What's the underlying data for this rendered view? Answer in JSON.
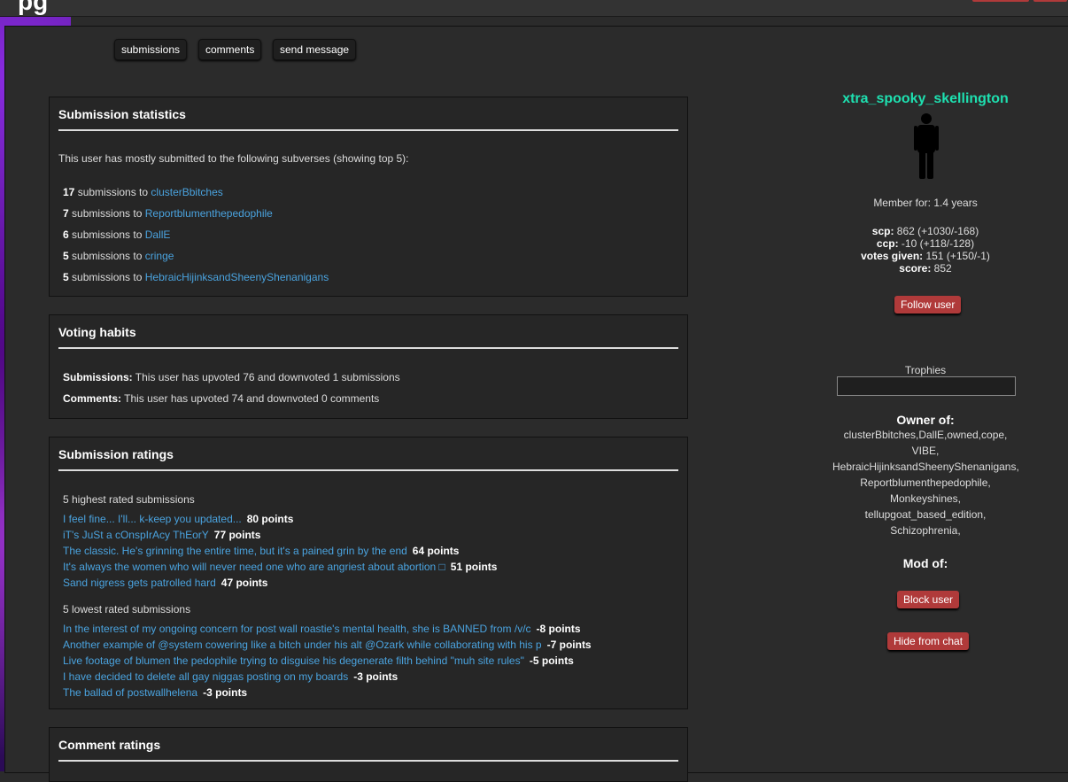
{
  "tabs": [
    "submissions",
    "comments",
    "send message"
  ],
  "stats": {
    "title": "Submission statistics",
    "intro": "This user has mostly submitted to the following subverses (showing top 5):",
    "rows": [
      {
        "count": "17",
        "text": " submissions to ",
        "sub": "clusterBbitches"
      },
      {
        "count": "7",
        "text": " submissions to ",
        "sub": "Reportblumenthepedophile"
      },
      {
        "count": "6",
        "text": " submissions to ",
        "sub": "DallE"
      },
      {
        "count": "5",
        "text": " submissions to ",
        "sub": "cringe"
      },
      {
        "count": "5",
        "text": " submissions to ",
        "sub": "HebraicHijinksandSheenyShenanigans"
      }
    ]
  },
  "voting": {
    "title": "Voting habits",
    "submissions_label": "Submissions:",
    "submissions_text": " This user has upvoted 76 and downvoted 1 submissions",
    "comments_label": "Comments:",
    "comments_text": " This user has upvoted 74 and downvoted 0 comments"
  },
  "ratings": {
    "title": "Submission ratings",
    "highest_label": "5 highest rated submissions",
    "highest": [
      {
        "title": "I feel fine... I'll... k-keep you updated...",
        "points": "80 points"
      },
      {
        "title": "iT's JuSt a cOnspIrAcy ThEorY",
        "points": "77 points"
      },
      {
        "title": "The classic. He's grinning the entire time, but it's a pained grin by the end",
        "points": "64 points"
      },
      {
        "title": "It's always the women who will never need one who are angriest about abortion □",
        "points": "51 points"
      },
      {
        "title": "Sand nigress gets patrolled hard",
        "points": "47 points"
      }
    ],
    "lowest_label": "5 lowest rated submissions",
    "lowest": [
      {
        "title": "In the interest of my ongoing concern for post wall roastie's mental health, she is BANNED from /v/c",
        "points": "-8 points"
      },
      {
        "title": "Another example of @system cowering like a bitch under his alt @Ozark while collaborating with his p",
        "points": "-7 points"
      },
      {
        "title": "Live footage of blumen the pedophile trying to disguise his degenerate filth behind \"muh site rules\"",
        "points": "-5 points"
      },
      {
        "title": "I have decided to delete all gay niggas posting on my boards",
        "points": "-3 points"
      },
      {
        "title": "The ballad of postwallhelena",
        "points": "-3 points"
      }
    ]
  },
  "comment_ratings": {
    "title": "Comment ratings"
  },
  "profile": {
    "username": "xtra_spooky_skellington",
    "member_for": "Member for: 1.4 years",
    "scp_label": "scp:",
    "scp_value": " 862 (+1030/-168)",
    "ccp_label": "ccp:",
    "ccp_value": " -10 (+118/-128)",
    "votes_label": "votes given:",
    "votes_value": " 151 (+150/-1)",
    "score_label": "score:",
    "score_value": " 852",
    "follow": "Follow user",
    "trophies": "Trophies",
    "owner_label": "Owner of:",
    "owner_lines": [
      "clusterBbitches,DallE,owned,cope,",
      "VIBE,",
      "HebraicHijinksandSheenyShenanigans,",
      "Reportblumenthepedophile,",
      "Monkeyshines,",
      "tellupgoat_based_edition,",
      "Schizophrenia,"
    ],
    "mod_label": "Mod of:",
    "block": "Block user",
    "hide": "Hide from chat"
  },
  "colors": {
    "accent_green": "#1ee0b0",
    "link": "#4aa3df",
    "button_red": "#b03a3a"
  }
}
